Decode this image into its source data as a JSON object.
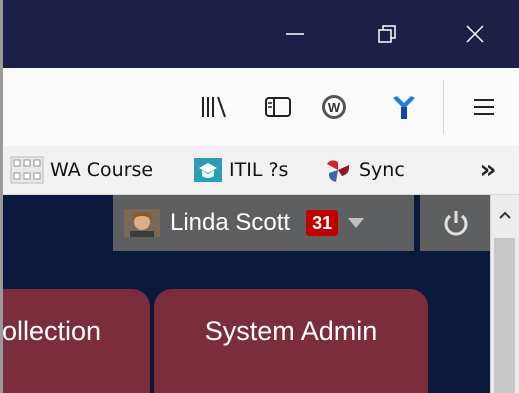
{
  "window": {
    "controls": [
      "minimize",
      "restore",
      "close"
    ]
  },
  "toolbar": {
    "icons": [
      "library-icon",
      "sidebar-icon",
      "w-extension-icon",
      "y-extension-icon",
      "hamburger-menu-icon"
    ]
  },
  "bookmarks": {
    "items": [
      {
        "label": "WA Course",
        "icon": "wa-course-icon"
      },
      {
        "label": "ITIL ?s",
        "icon": "itil-icon"
      },
      {
        "label": "Sync",
        "icon": "sync-icon"
      }
    ],
    "overflow": "»"
  },
  "user": {
    "name": "Linda Scott",
    "notification_count": "31"
  },
  "tabs": [
    {
      "label": "ollection"
    },
    {
      "label": "System Admin"
    }
  ],
  "colors": {
    "titlebar": "#1d1f47",
    "page_bg": "#0b1a3c",
    "user_bar": "#5d5f61",
    "tab": "#7b2d3c",
    "badge": "#c00000"
  }
}
